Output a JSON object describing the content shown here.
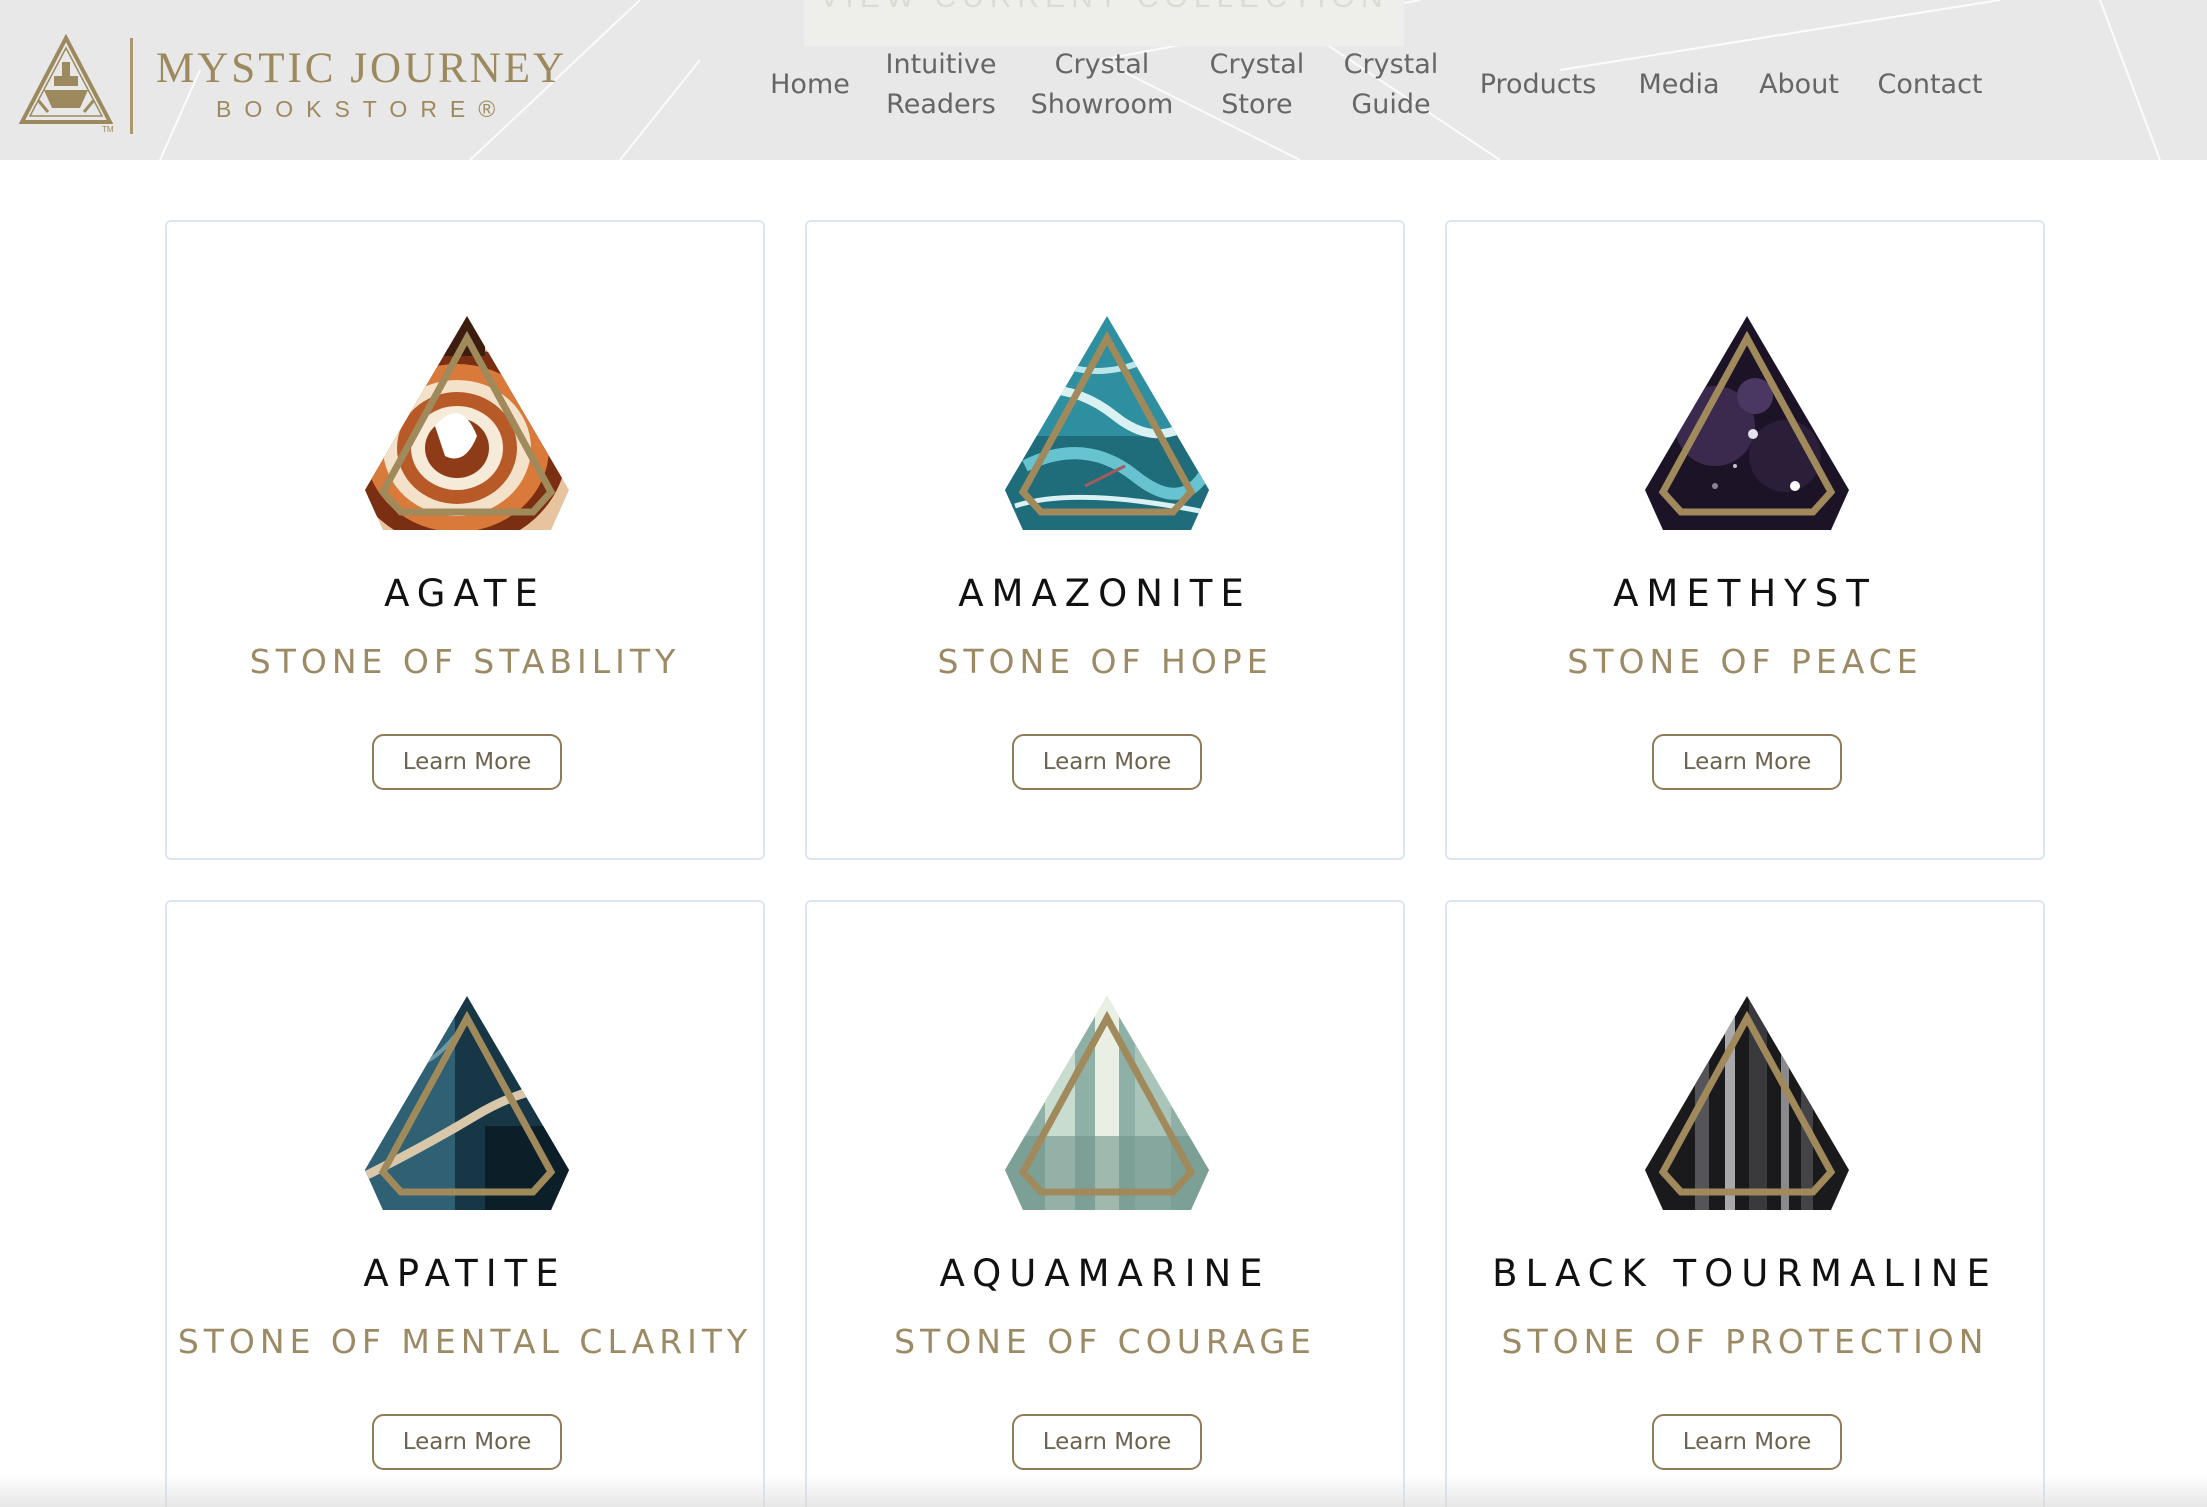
{
  "header": {
    "banner_text": "VIEW CURRENT COLLECTION",
    "logo": {
      "title": "MYSTIC JOURNEY",
      "subtitle": "BOOKSTORE®",
      "mark_icon": "ship-triangle-icon",
      "brand_color": "#9c8a5e"
    },
    "nav": [
      {
        "label": "Home"
      },
      {
        "label": "Intuitive\nReaders"
      },
      {
        "label": "Crystal\nShowroom"
      },
      {
        "label": "Crystal\nStore"
      },
      {
        "label": "Crystal\nGuide"
      },
      {
        "label": "Products"
      },
      {
        "label": "Media"
      },
      {
        "label": "About"
      },
      {
        "label": "Contact"
      }
    ]
  },
  "crystals": [
    {
      "name": "AGATE",
      "subtitle": "STONE OF STABILITY",
      "button": "Learn More",
      "icon": "agate-gem-icon",
      "colors": [
        "#7a2e12",
        "#d97a3a",
        "#f3e1c9",
        "#3c1d10"
      ]
    },
    {
      "name": "AMAZONITE",
      "subtitle": "STONE OF HOPE",
      "button": "Learn More",
      "icon": "amazonite-gem-icon",
      "colors": [
        "#2e8fa0",
        "#66c3cf",
        "#d9f1f3",
        "#1f6c7a"
      ]
    },
    {
      "name": "AMETHYST",
      "subtitle": "STONE OF PEACE",
      "button": "Learn More",
      "icon": "amethyst-gem-icon",
      "colors": [
        "#1c1326",
        "#3b2a4e",
        "#8d7ea3",
        "#0e0a14"
      ]
    },
    {
      "name": "APATITE",
      "subtitle": "STONE OF MENTAL CLARITY",
      "button": "Learn More",
      "icon": "apatite-gem-icon",
      "colors": [
        "#173746",
        "#2f6074",
        "#d8c7a9",
        "#0c1e28"
      ]
    },
    {
      "name": "AQUAMARINE",
      "subtitle": "STONE OF COURAGE",
      "button": "Learn More",
      "icon": "aquamarine-gem-icon",
      "colors": [
        "#8fb0a6",
        "#c8dcd0",
        "#e9efe3",
        "#6f948c"
      ]
    },
    {
      "name": "BLACK TOURMALINE",
      "subtitle": "STONE OF PROTECTION",
      "button": "Learn More",
      "icon": "black-tourmaline-gem-icon",
      "colors": [
        "#1a1a1c",
        "#555559",
        "#a9a9ad",
        "#0b0b0c"
      ]
    }
  ],
  "colors": {
    "accent_gold": "#9c8a65",
    "button_border": "#8d7c55",
    "card_border": "#dbe6f1",
    "header_bg": "#e8e8e8",
    "nav_text": "#666666"
  }
}
